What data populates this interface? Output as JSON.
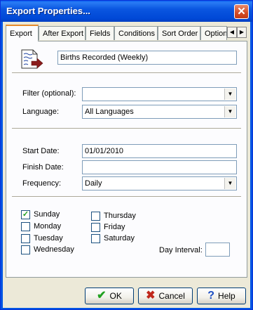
{
  "window": {
    "title": "Export Properties..."
  },
  "tabs": [
    "Export",
    "After Export",
    "Fields",
    "Conditions",
    "Sort Order",
    "Option"
  ],
  "icons": {
    "close": "close-icon",
    "tab_left": "chevron-left-icon",
    "tab_right": "chevron-right-icon",
    "doc": "export-document-icon",
    "ok": "check-icon",
    "cancel": "x-icon",
    "help": "help-icon"
  },
  "export": {
    "name_value": "Births Recorded (Weekly)",
    "filter_label": "Filter (optional):",
    "filter_value": "",
    "language_label": "Language:",
    "language_value": "All Languages",
    "start_label": "Start Date:",
    "start_value": "01/01/2010",
    "finish_label": "Finish Date:",
    "finish_value": "",
    "frequency_label": "Frequency:",
    "frequency_value": "Daily",
    "days": [
      {
        "label": "Sunday",
        "checked": true
      },
      {
        "label": "Monday",
        "checked": false
      },
      {
        "label": "Tuesday",
        "checked": false
      },
      {
        "label": "Wednesday",
        "checked": false
      },
      {
        "label": "Thursday",
        "checked": false
      },
      {
        "label": "Friday",
        "checked": false
      },
      {
        "label": "Saturday",
        "checked": false
      }
    ],
    "day_interval_label": "Day Interval:",
    "day_interval_value": ""
  },
  "buttons": {
    "ok": "OK",
    "cancel": "Cancel",
    "help": "Help"
  },
  "colors": {
    "ok_check": "#21a121",
    "cancel_x": "#c0281c",
    "help_q": "#1d4fc4"
  }
}
